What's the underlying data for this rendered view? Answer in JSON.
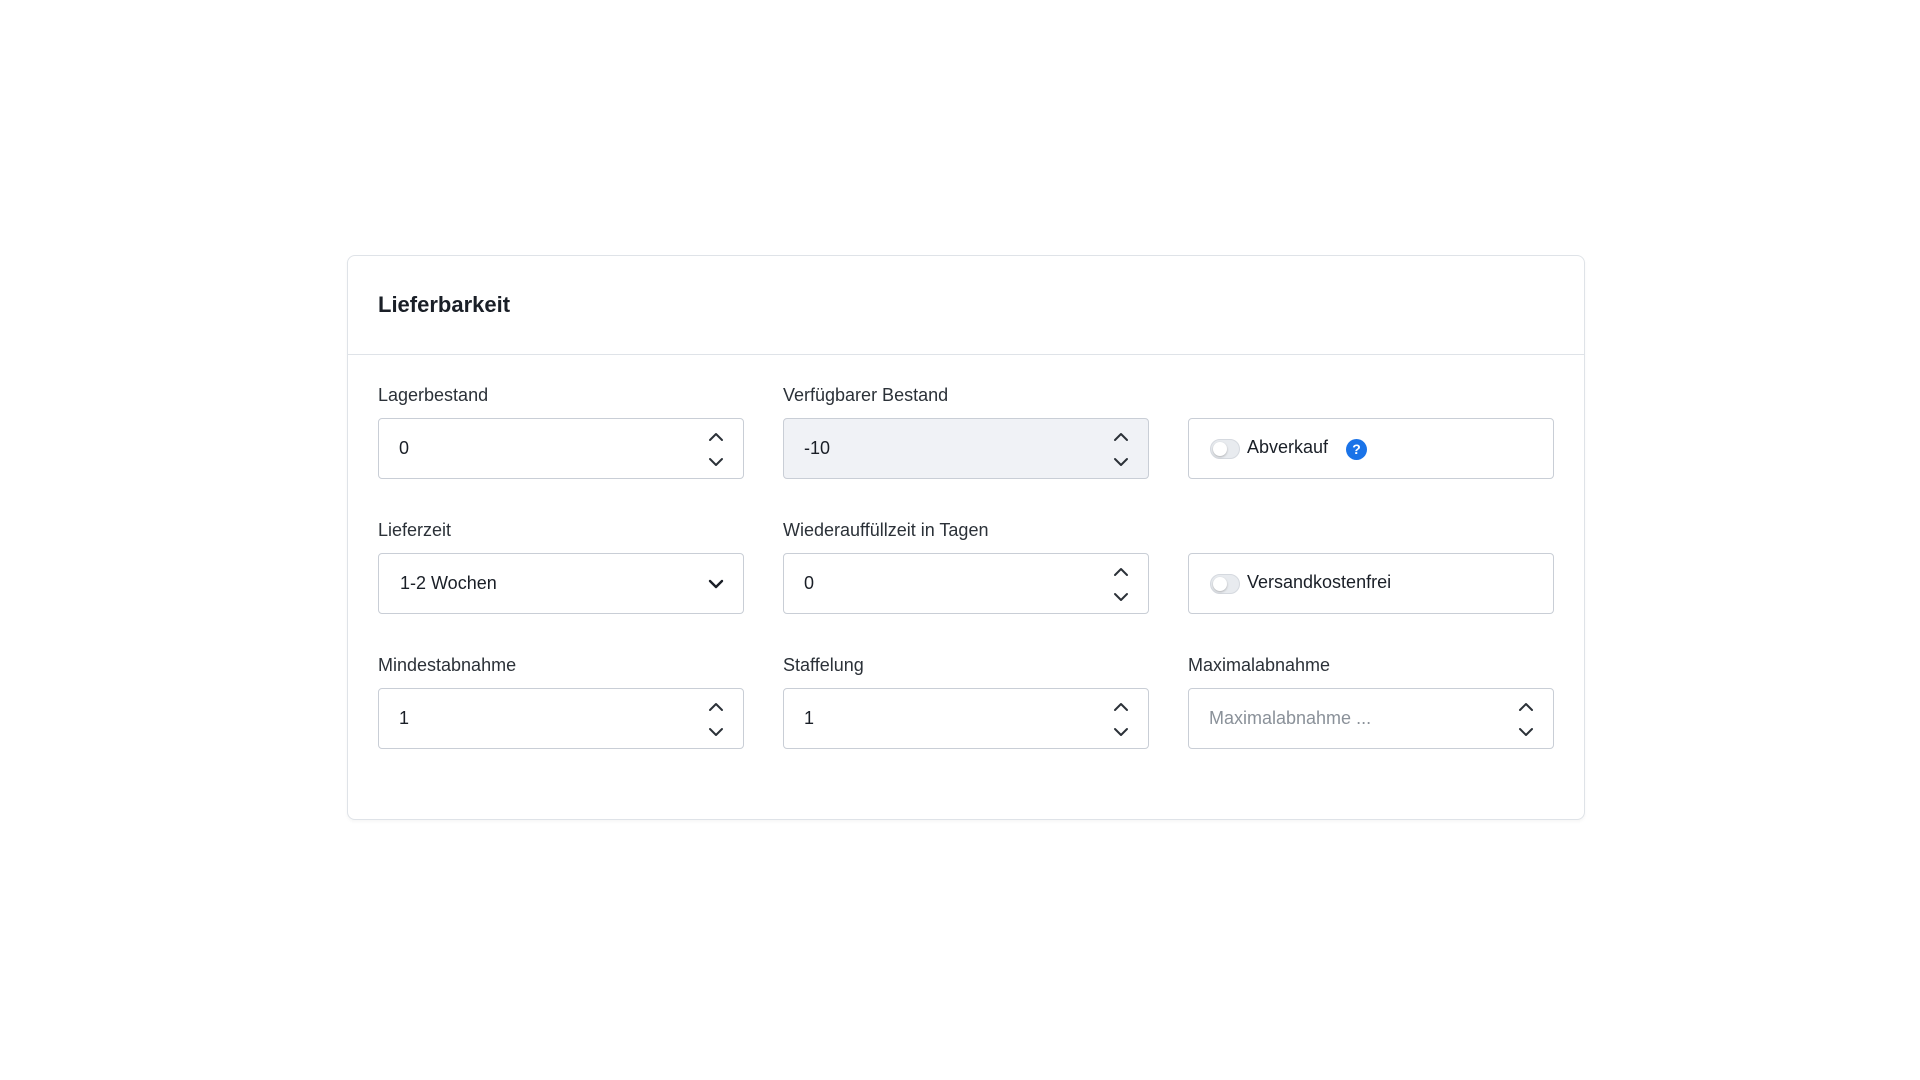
{
  "card": {
    "title": "Lieferbarkeit"
  },
  "fields": {
    "stock": {
      "label": "Lagerbestand",
      "value": "0"
    },
    "available_stock": {
      "label": "Verfügbarer Bestand",
      "value": "-10"
    },
    "clearance": {
      "label": "Abverkauf",
      "enabled": false,
      "help_icon": "question-icon"
    },
    "delivery_time": {
      "label": "Lieferzeit",
      "value": "1-2 Wochen"
    },
    "restock_time": {
      "label": "Wiederauffüllzeit in Tagen",
      "value": "0"
    },
    "free_shipping": {
      "label": "Versandkostenfrei",
      "enabled": false
    },
    "min_purchase": {
      "label": "Mindestabnahme",
      "value": "1"
    },
    "purchase_steps": {
      "label": "Staffelung",
      "value": "1"
    },
    "max_purchase": {
      "label": "Maximalabnahme",
      "value": "",
      "placeholder": "Maximalabnahme ..."
    }
  },
  "icons": {
    "stepper_up": "chevron-up-icon",
    "stepper_down": "chevron-down-icon",
    "select": "chevron-down-icon",
    "help": "question-icon"
  },
  "colors": {
    "accent": "#1a73e8",
    "border": "#c9ced6",
    "disabled_bg": "#f0f2f6"
  }
}
